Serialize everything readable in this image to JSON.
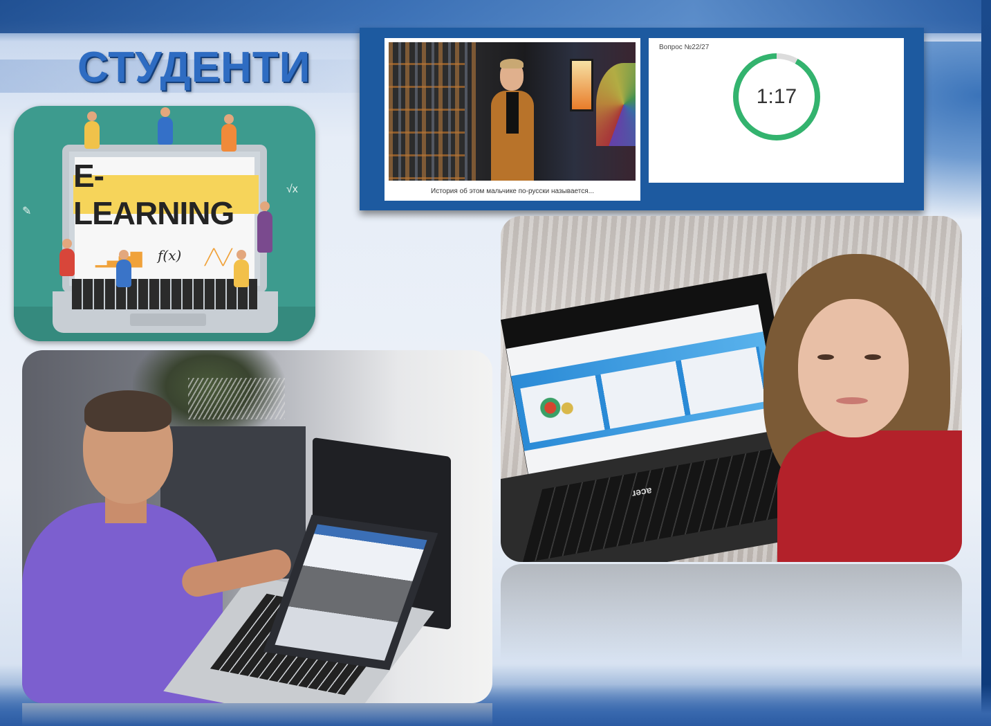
{
  "slide": {
    "title": "СТУДЕНТИ"
  },
  "elearning_illustration": {
    "banner_text": "E-LEARNING",
    "formula_text": "f(x)",
    "icons": [
      "bar-chart-icon",
      "function-icon",
      "line-chart-icon",
      "pencil-icon",
      "sqrt-icon"
    ]
  },
  "quiz_screen": {
    "video_caption": "История об этом мальчике по-русски называется...",
    "question_label": "Вопрос №22/27",
    "timer_value": "1:17",
    "timer_progress": 0.92,
    "colors": {
      "panel": "#1d5aa0",
      "timer_ring": "#33b36e",
      "timer_track": "#dcdcdc"
    }
  },
  "photo_man": {
    "description_icon": "person-at-laptop-photo"
  },
  "photo_woman": {
    "laptop_brand": "acer",
    "description_icon": "person-at-laptop-photo"
  }
}
